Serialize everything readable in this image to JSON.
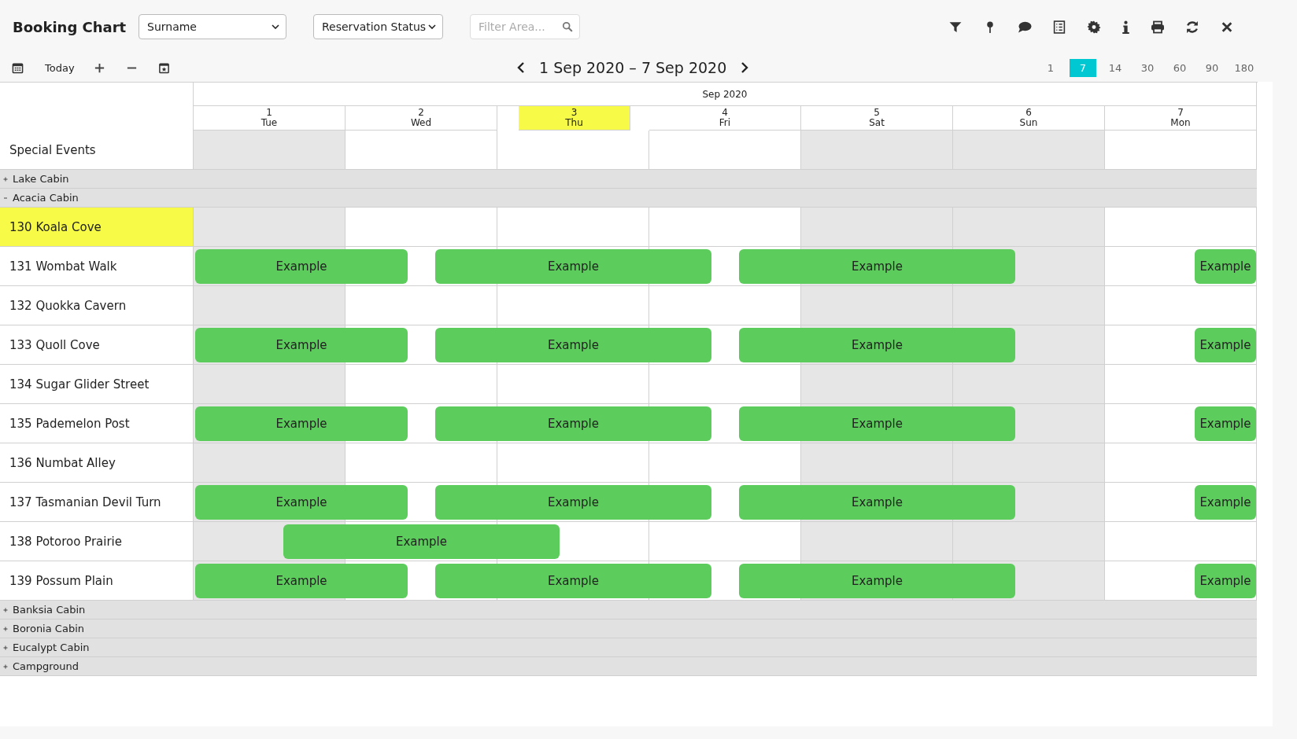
{
  "title": "Booking Chart",
  "sort_select": {
    "value": "Surname"
  },
  "status_select": {
    "value": "Reservation Status"
  },
  "filter": {
    "placeholder": "Filter Area..."
  },
  "today_button": "Today",
  "date_range": "1 Sep 2020 – 7 Sep 2020",
  "periods": [
    {
      "label": "1",
      "selected": false
    },
    {
      "label": "7",
      "selected": true
    },
    {
      "label": "14",
      "selected": false
    },
    {
      "label": "30",
      "selected": false
    },
    {
      "label": "60",
      "selected": false
    },
    {
      "label": "90",
      "selected": false
    },
    {
      "label": "180",
      "selected": false
    }
  ],
  "month": "Sep 2020",
  "days": [
    {
      "date": "1",
      "weekday": "Tue",
      "shaded": true,
      "today": false
    },
    {
      "date": "2",
      "weekday": "Wed",
      "shaded": false,
      "today": false
    },
    {
      "date": "3",
      "weekday": "Thu",
      "shaded": false,
      "today": true
    },
    {
      "date": "4",
      "weekday": "Fri",
      "shaded": false,
      "today": false
    },
    {
      "date": "5",
      "weekday": "Sat",
      "shaded": true,
      "today": false
    },
    {
      "date": "6",
      "weekday": "Sun",
      "shaded": true,
      "today": false
    },
    {
      "date": "7",
      "weekday": "Mon",
      "shaded": false,
      "today": false
    }
  ],
  "special_events": {
    "label": "Special Events"
  },
  "groups": [
    {
      "name": "Lake Cabin",
      "expanded": false
    },
    {
      "name": "Acacia Cabin",
      "expanded": true,
      "rooms": [
        {
          "name": "130 Koala Cove",
          "highlighted": true
        },
        {
          "name": "131 Wombat Walk",
          "highlighted": false,
          "bookings": [
            {
              "label": "Example",
              "kind": "carry_in"
            },
            {
              "label": "Example",
              "kind": "stay"
            },
            {
              "label": "Example",
              "kind": "stay"
            },
            {
              "label": "Example",
              "kind": "carry_out"
            }
          ]
        },
        {
          "name": "132 Quokka Cavern",
          "highlighted": false
        },
        {
          "name": "133 Quoll Cove",
          "highlighted": false,
          "bookings": [
            {
              "label": "Example",
              "kind": "carry_in"
            },
            {
              "label": "Example",
              "kind": "stay"
            },
            {
              "label": "Example",
              "kind": "stay"
            },
            {
              "label": "Example",
              "kind": "carry_out"
            }
          ]
        },
        {
          "name": "134 Sugar Glider Street",
          "highlighted": false
        },
        {
          "name": "135 Pademelon Post",
          "highlighted": false,
          "bookings": [
            {
              "label": "Example",
              "kind": "carry_in"
            },
            {
              "label": "Example",
              "kind": "stay"
            },
            {
              "label": "Example",
              "kind": "stay"
            },
            {
              "label": "Example",
              "kind": "carry_out"
            }
          ]
        },
        {
          "name": "136 Numbat Alley",
          "highlighted": false
        },
        {
          "name": "137 Tasmanian Devil Turn",
          "highlighted": false,
          "bookings": [
            {
              "label": "Example",
              "kind": "carry_in"
            },
            {
              "label": "Example",
              "kind": "stay"
            },
            {
              "label": "Example",
              "kind": "stay"
            },
            {
              "label": "Example",
              "kind": "carry_out"
            }
          ]
        },
        {
          "name": "138 Potoroo Prairie",
          "highlighted": false,
          "bookings": [
            {
              "label": "Example",
              "kind": "stay"
            }
          ]
        },
        {
          "name": "139 Possum Plain",
          "highlighted": false,
          "bookings": [
            {
              "label": "Example",
              "kind": "carry_in"
            },
            {
              "label": "Example",
              "kind": "stay"
            },
            {
              "label": "Example",
              "kind": "stay"
            },
            {
              "label": "Example",
              "kind": "carry_out"
            }
          ]
        }
      ]
    },
    {
      "name": "Banksia Cabin",
      "expanded": false
    },
    {
      "name": "Boronia Cabin",
      "expanded": false
    },
    {
      "name": "Eucalypt Cabin",
      "expanded": false
    },
    {
      "name": "Campground",
      "expanded": false
    }
  ]
}
